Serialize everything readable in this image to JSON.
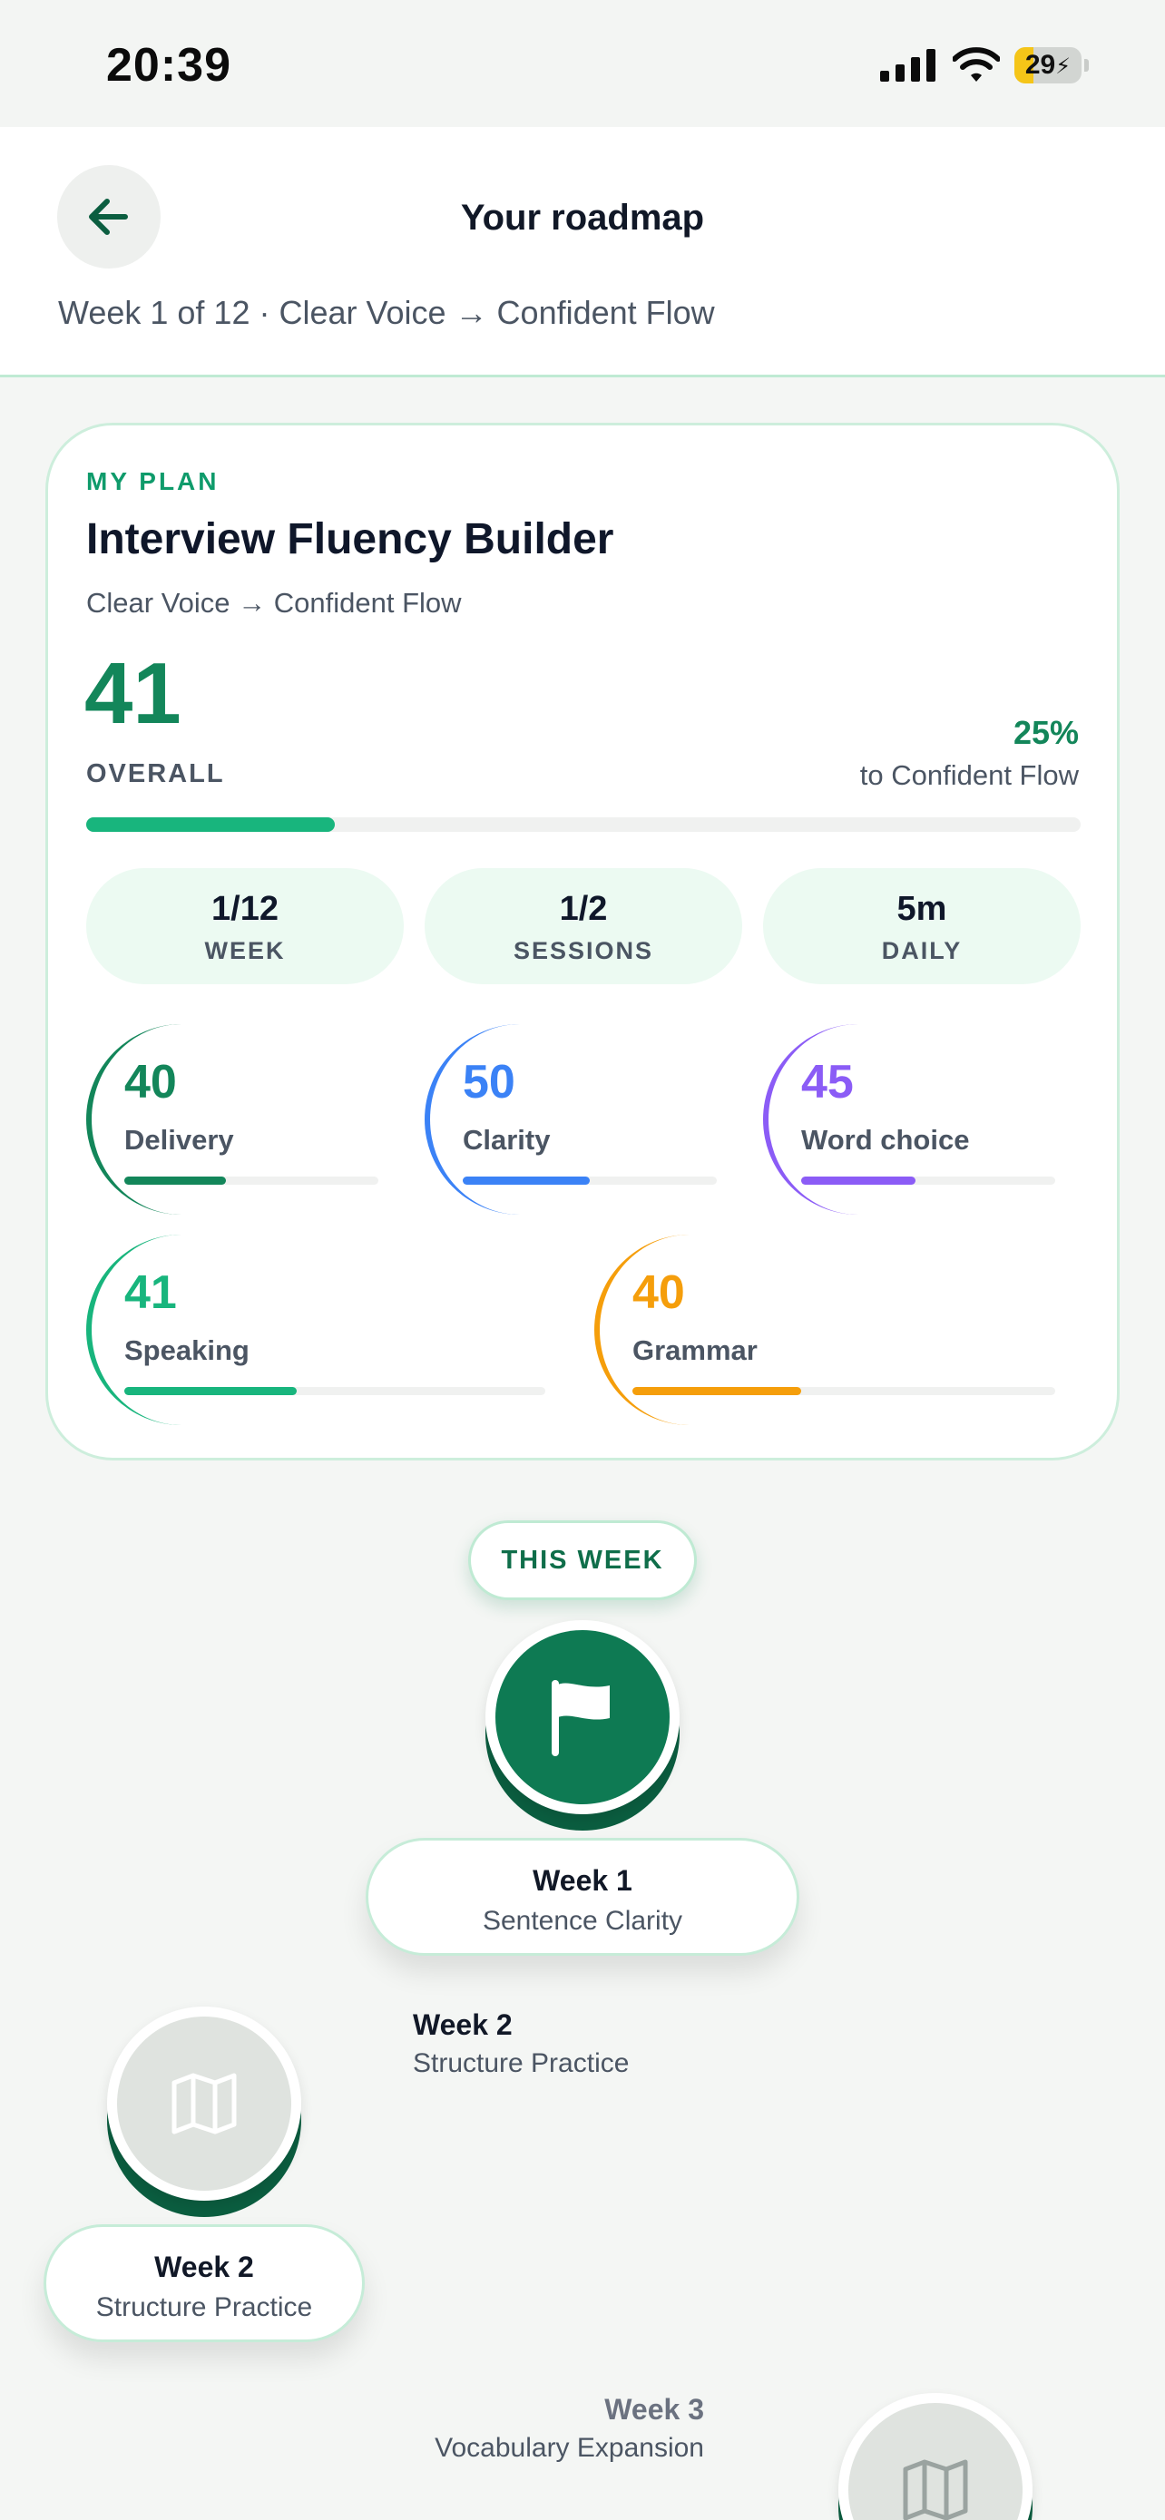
{
  "status_bar": {
    "time": "20:39",
    "battery_percent": 29,
    "battery_text": "29"
  },
  "header": {
    "title": "Your roadmap",
    "subtitle": "Week 1 of 12 · Clear Voice → Confident Flow",
    "back_icon": "arrow-left-icon"
  },
  "plan": {
    "eyebrow": "MY PLAN",
    "title": "Interview Fluency Builder",
    "subtitle": "Clear Voice → Confident Flow",
    "overall_score": "41",
    "overall_label": "OVERALL",
    "progress_percent_text": "25%",
    "progress_target": "to Confident Flow",
    "progress_fraction": 0.25,
    "stats": [
      {
        "value": "1/12",
        "label": "WEEK"
      },
      {
        "value": "1/2",
        "label": "SESSIONS"
      },
      {
        "value": "5m",
        "label": "DAILY"
      }
    ],
    "skills": [
      {
        "score": "40",
        "name": "Delivery",
        "fraction": 0.4,
        "color": "#13865a"
      },
      {
        "score": "50",
        "name": "Clarity",
        "fraction": 0.5,
        "color": "#3b82f6"
      },
      {
        "score": "45",
        "name": "Word choice",
        "fraction": 0.45,
        "color": "#8b5cf6"
      },
      {
        "score": "41",
        "name": "Speaking",
        "fraction": 0.41,
        "color": "#18b57d"
      },
      {
        "score": "40",
        "name": "Grammar",
        "fraction": 0.4,
        "color": "#f59e0b"
      }
    ]
  },
  "roadmap": {
    "this_week_label": "THIS WEEK",
    "weeks": [
      {
        "title": "Week 1",
        "subtitle": "Sentence Clarity",
        "icon": "flag-icon"
      },
      {
        "title": "Week 2",
        "subtitle": "Structure Practice",
        "icon": "map-icon"
      },
      {
        "title": "Week 3",
        "subtitle": "Vocabulary Expansion",
        "icon": "map-icon"
      }
    ]
  },
  "colors": {
    "accent": "#13865a",
    "accent_dark": "#0b5e40",
    "mint": "#ecfaf2"
  }
}
